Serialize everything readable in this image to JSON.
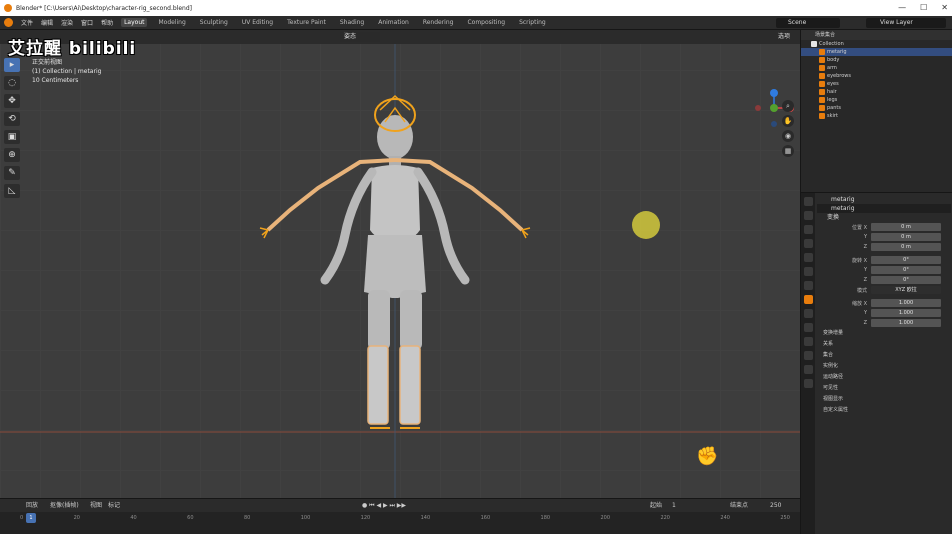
{
  "titlebar": {
    "title": "Blender* [C:\\Users\\Ai\\Desktop\\character-rig_second.blend]",
    "buttons": [
      "—",
      "☐",
      "✕"
    ]
  },
  "menubar": {
    "menus": [
      "文件",
      "编辑",
      "渲染",
      "窗口",
      "帮助"
    ],
    "workspaces": [
      "Layout",
      "Modeling",
      "Sculpting",
      "UV Editing",
      "Texture Paint",
      "Shading",
      "Animation",
      "Rendering",
      "Compositing",
      "Scripting"
    ],
    "active_workspace": "Layout",
    "scene": "Scene",
    "view_layer": "View Layer"
  },
  "watermark": "艾拉醒 bilibili",
  "viewport": {
    "mode": "姿态",
    "options_label": "选项",
    "info_lines": [
      "正交前视图",
      "(1) Collection | metarig",
      "10 Centimeters"
    ]
  },
  "tools": [
    "▸",
    "◌",
    "✥",
    "⟲",
    "▣",
    "⊕",
    "✎",
    "◺"
  ],
  "timeline": {
    "menus": [
      "回放",
      "抠像(插帧)",
      "视图",
      "标记"
    ],
    "start_label": "起始",
    "start": "1",
    "end_label": "结束点",
    "end": "250",
    "current_frame": "1",
    "ruler": [
      "0",
      "20",
      "40",
      "60",
      "80",
      "100",
      "120",
      "140",
      "160",
      "180",
      "200",
      "220",
      "240",
      "250"
    ]
  },
  "outliner": {
    "header": "场景集合",
    "rows": [
      {
        "name": "Collection",
        "color": "#e6e6e6"
      },
      {
        "name": "metarig",
        "color": "#e87d0d",
        "selected": true
      },
      {
        "name": "body",
        "color": "#e87d0d"
      },
      {
        "name": "arm",
        "color": "#e87d0d"
      },
      {
        "name": "eyebrows",
        "color": "#e87d0d"
      },
      {
        "name": "eyes",
        "color": "#e87d0d"
      },
      {
        "name": "hair",
        "color": "#e87d0d"
      },
      {
        "name": "legs",
        "color": "#e87d0d"
      },
      {
        "name": "pants",
        "color": "#e87d0d"
      },
      {
        "name": "skirt",
        "color": "#e87d0d"
      }
    ]
  },
  "properties": {
    "object_name": "metarig",
    "data_name": "metarig",
    "transform_header": "变换",
    "location_label": "位置 X",
    "location": [
      "0 m",
      "0 m",
      "0 m"
    ],
    "rotation_label": "旋转 X",
    "rotation": [
      "0°",
      "0°",
      "0°"
    ],
    "mode_label": "模式",
    "mode_value": "XYZ 欧拉",
    "scale_label": "缩放 X",
    "scale": [
      "1.000",
      "1.000",
      "1.000"
    ],
    "sections": [
      "变换增量",
      "关系",
      "集合",
      "实例化",
      "运动路径",
      "可见性",
      "视图显示",
      "自定义属性"
    ]
  }
}
